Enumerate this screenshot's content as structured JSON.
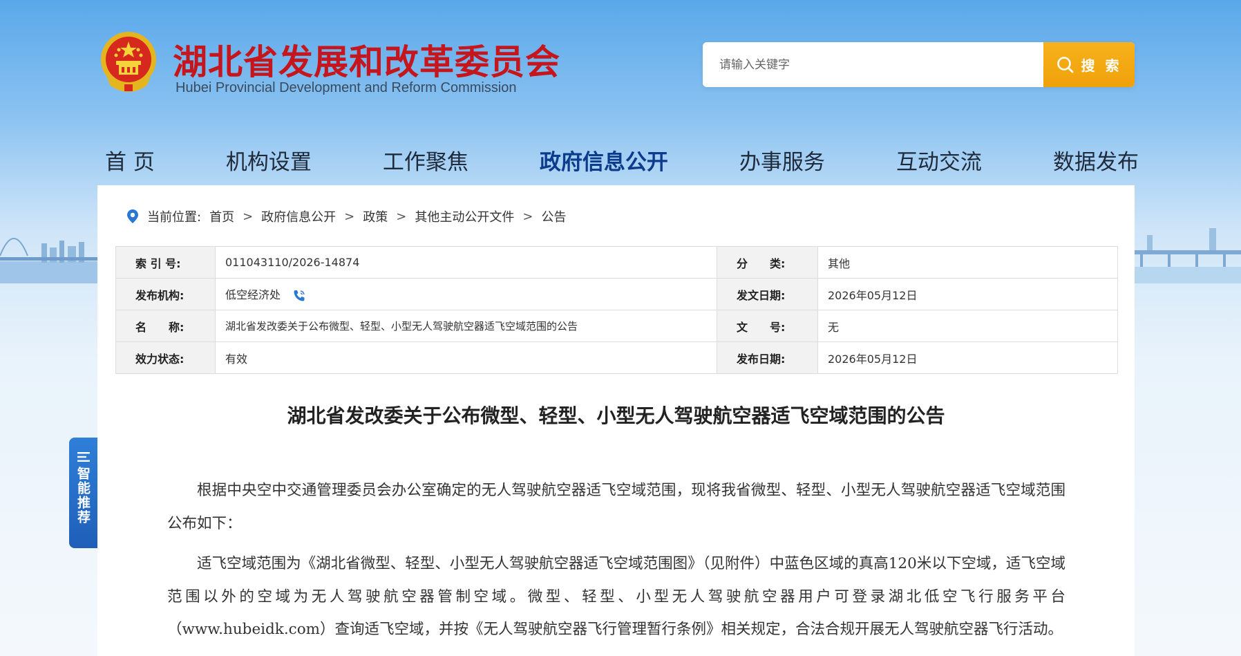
{
  "header": {
    "title": "湖北省发展和改革委员会",
    "subtitle": "Hubei Provincial Development and Reform Commission",
    "search_placeholder": "请输入关键字",
    "search_button": "搜 索"
  },
  "nav": {
    "items": [
      {
        "label": "首 页"
      },
      {
        "label": "机构设置"
      },
      {
        "label": "工作聚焦"
      },
      {
        "label": "政府信息公开"
      },
      {
        "label": "办事服务"
      },
      {
        "label": "互动交流"
      },
      {
        "label": "数据发布"
      }
    ],
    "active": "政府信息公开"
  },
  "breadcrumb": {
    "lead": "当前位置:",
    "items": [
      "首页",
      "政府信息公开",
      "政策",
      "其他主动公开文件",
      "公告"
    ],
    "separator": ">"
  },
  "meta": {
    "index_label": "索 引 号:",
    "index_value": "011043110/2026-14874",
    "category_label": "分　　类:",
    "category_value": "其他",
    "org_label": "发布机构:",
    "org_value": "低空经济处",
    "date_label": "发文日期:",
    "date_value": "2026年05月12日",
    "name_label": "名　　称:",
    "name_value": "湖北省发改委关于公布微型、轻型、小型无人驾驶航空器适飞空域范围的公告",
    "docno_label": "文　　号:",
    "docno_value": "无",
    "status_label": "效力状态:",
    "status_value": "有效",
    "pub_label": "发布日期:",
    "pub_value": "2026年05月12日"
  },
  "article": {
    "title": "湖北省发改委关于公布微型、轻型、小型无人驾驶航空器适飞空域范围的公告",
    "paragraphs": [
      "根据中央空中交通管理委员会办公室确定的无人驾驶航空器适飞空域范围，现将我省微型、轻型、小型无人驾驶航空器适飞空域范围公布如下：",
      "适飞空域范围为《湖北省微型、轻型、小型无人驾驶航空器适飞空域范围图》（见附件）中蓝色区域的真高120米以下空域，适飞空域范围以外的空域为无人驾驶航空器管制空域。微型、轻型、小型无人驾驶航空器用户可登录湖北低空飞行服务平台（www.hubeidk.com）查询适飞空域，并按《无人驾驶航空器飞行管理暂行条例》相关规定，合法合规开展无人驾驶航空器飞行活动。"
    ]
  },
  "side_tab": {
    "label": "智能推荐"
  },
  "colors": {
    "brand_red": "#c4161c",
    "search_orange": "#f0a10a",
    "nav_active": "#0d3b8c",
    "side_blue": "#1f5fb8"
  }
}
